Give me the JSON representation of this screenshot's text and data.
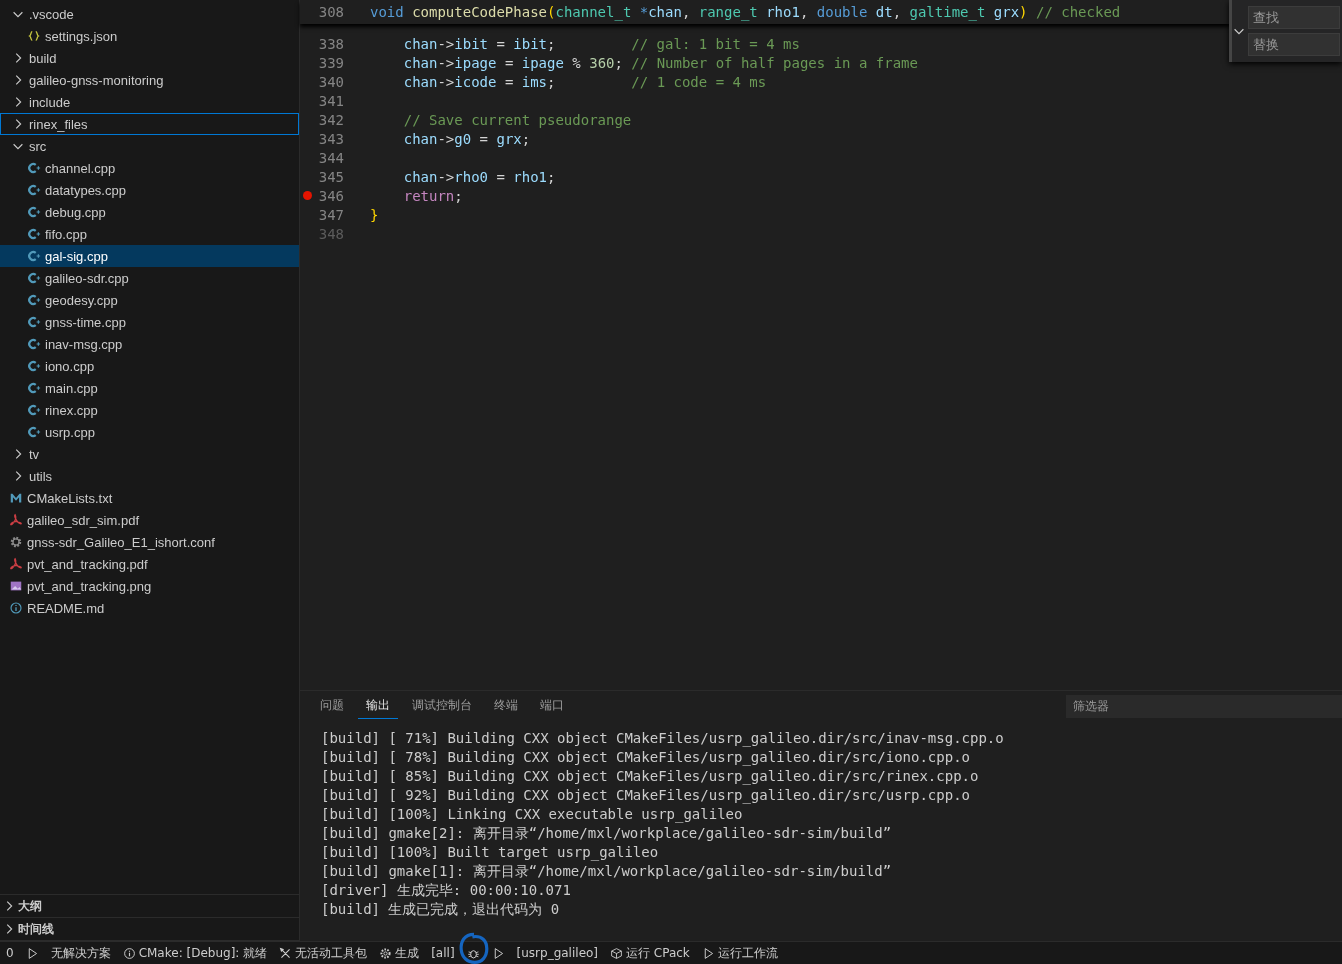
{
  "explorer": {
    "items": [
      {
        "kind": "folder",
        "label": ".vscode",
        "expanded": true,
        "selected": false,
        "focused": false,
        "children": [
          {
            "kind": "json",
            "label": "settings.json",
            "selected": false,
            "focused": false
          }
        ]
      },
      {
        "kind": "folder",
        "label": "build",
        "expanded": false,
        "selected": false,
        "focused": false
      },
      {
        "kind": "folder",
        "label": "galileo-gnss-monitoring",
        "expanded": false,
        "selected": false,
        "focused": false
      },
      {
        "kind": "folder",
        "label": "include",
        "expanded": false,
        "selected": false,
        "focused": false
      },
      {
        "kind": "folder",
        "label": "rinex_files",
        "expanded": false,
        "selected": false,
        "focused": true
      },
      {
        "kind": "folder",
        "label": "src",
        "expanded": true,
        "selected": false,
        "focused": false,
        "children": [
          {
            "kind": "cpp",
            "label": "channel.cpp",
            "selected": false,
            "focused": false
          },
          {
            "kind": "cpp",
            "label": "datatypes.cpp",
            "selected": false,
            "focused": false
          },
          {
            "kind": "cpp",
            "label": "debug.cpp",
            "selected": false,
            "focused": false
          },
          {
            "kind": "cpp",
            "label": "fifo.cpp",
            "selected": false,
            "focused": false
          },
          {
            "kind": "cpp",
            "label": "gal-sig.cpp",
            "selected": true,
            "focused": false
          },
          {
            "kind": "cpp",
            "label": "galileo-sdr.cpp",
            "selected": false,
            "focused": false
          },
          {
            "kind": "cpp",
            "label": "geodesy.cpp",
            "selected": false,
            "focused": false
          },
          {
            "kind": "cpp",
            "label": "gnss-time.cpp",
            "selected": false,
            "focused": false
          },
          {
            "kind": "cpp",
            "label": "inav-msg.cpp",
            "selected": false,
            "focused": false
          },
          {
            "kind": "cpp",
            "label": "iono.cpp",
            "selected": false,
            "focused": false
          },
          {
            "kind": "cpp",
            "label": "main.cpp",
            "selected": false,
            "focused": false
          },
          {
            "kind": "cpp",
            "label": "rinex.cpp",
            "selected": false,
            "focused": false
          },
          {
            "kind": "cpp",
            "label": "usrp.cpp",
            "selected": false,
            "focused": false
          }
        ]
      },
      {
        "kind": "folder",
        "label": "tv",
        "expanded": false,
        "selected": false,
        "focused": false
      },
      {
        "kind": "folder",
        "label": "utils",
        "expanded": false,
        "selected": false,
        "focused": false
      },
      {
        "kind": "cmake",
        "label": "CMakeLists.txt",
        "selected": false,
        "focused": false
      },
      {
        "kind": "pdf",
        "label": "galileo_sdr_sim.pdf",
        "selected": false,
        "focused": false
      },
      {
        "kind": "conf",
        "label": "gnss-sdr_Galileo_E1_ishort.conf",
        "selected": false,
        "focused": false
      },
      {
        "kind": "pdf",
        "label": "pvt_and_tracking.pdf",
        "selected": false,
        "focused": false
      },
      {
        "kind": "image",
        "label": "pvt_and_tracking.png",
        "selected": false,
        "focused": false
      },
      {
        "kind": "info",
        "label": "README.md",
        "selected": false,
        "focused": false
      }
    ]
  },
  "sidebar_sections": [
    {
      "label": "大纲",
      "expanded": false
    },
    {
      "label": "时间线",
      "expanded": false
    }
  ],
  "editor": {
    "sticky_line": {
      "number": "308",
      "tokens": [
        {
          "kind": "kw",
          "text": "void "
        },
        {
          "kind": "fn",
          "text": "computeCodePhase"
        },
        {
          "kind": "paren",
          "text": "("
        },
        {
          "kind": "type",
          "text": "channel_t"
        },
        {
          "kind": "kw",
          "text": " *"
        },
        {
          "kind": "var",
          "text": "chan"
        },
        {
          "kind": "op",
          "text": ", "
        },
        {
          "kind": "type",
          "text": "range_t"
        },
        {
          "kind": "var",
          "text": " rho1"
        },
        {
          "kind": "op",
          "text": ", "
        },
        {
          "kind": "kw",
          "text": "double"
        },
        {
          "kind": "var",
          "text": " dt"
        },
        {
          "kind": "op",
          "text": ", "
        },
        {
          "kind": "type",
          "text": "galtime_t"
        },
        {
          "kind": "var",
          "text": " grx"
        },
        {
          "kind": "paren",
          "text": ")"
        },
        {
          "kind": "cm",
          "text": " // checked"
        }
      ]
    },
    "lines": [
      {
        "number": "338",
        "breakpoint": false,
        "dim": false,
        "tokens": [
          {
            "kind": "var",
            "text": "    chan"
          },
          {
            "kind": "op",
            "text": "->"
          },
          {
            "kind": "var",
            "text": "ibit"
          },
          {
            "kind": "op",
            "text": " = "
          },
          {
            "kind": "var",
            "text": "ibit"
          },
          {
            "kind": "op",
            "text": ";         "
          },
          {
            "kind": "cm",
            "text": "// gal: 1 bit = 4 ms"
          }
        ]
      },
      {
        "number": "339",
        "breakpoint": false,
        "dim": false,
        "tokens": [
          {
            "kind": "var",
            "text": "    chan"
          },
          {
            "kind": "op",
            "text": "->"
          },
          {
            "kind": "var",
            "text": "ipage"
          },
          {
            "kind": "op",
            "text": " = "
          },
          {
            "kind": "var",
            "text": "ipage"
          },
          {
            "kind": "op",
            "text": " % "
          },
          {
            "kind": "num",
            "text": "360"
          },
          {
            "kind": "op",
            "text": "; "
          },
          {
            "kind": "cm",
            "text": "// Number of half pages in a frame"
          }
        ]
      },
      {
        "number": "340",
        "breakpoint": false,
        "dim": false,
        "tokens": [
          {
            "kind": "var",
            "text": "    chan"
          },
          {
            "kind": "op",
            "text": "->"
          },
          {
            "kind": "var",
            "text": "icode"
          },
          {
            "kind": "op",
            "text": " = "
          },
          {
            "kind": "var",
            "text": "ims"
          },
          {
            "kind": "op",
            "text": ";         "
          },
          {
            "kind": "cm",
            "text": "// 1 code = 4 ms"
          }
        ]
      },
      {
        "number": "341",
        "breakpoint": false,
        "dim": false
      },
      {
        "number": "342",
        "breakpoint": false,
        "dim": false,
        "tokens": [
          {
            "kind": "cm",
            "text": "    // Save current pseudorange"
          }
        ]
      },
      {
        "number": "343",
        "breakpoint": false,
        "dim": false,
        "tokens": [
          {
            "kind": "var",
            "text": "    chan"
          },
          {
            "kind": "op",
            "text": "->"
          },
          {
            "kind": "var",
            "text": "g0"
          },
          {
            "kind": "op",
            "text": " = "
          },
          {
            "kind": "var",
            "text": "grx"
          },
          {
            "kind": "op",
            "text": ";"
          }
        ]
      },
      {
        "number": "344",
        "breakpoint": false,
        "dim": false
      },
      {
        "number": "345",
        "breakpoint": false,
        "dim": false,
        "tokens": [
          {
            "kind": "var",
            "text": "    chan"
          },
          {
            "kind": "op",
            "text": "->"
          },
          {
            "kind": "var",
            "text": "rho0"
          },
          {
            "kind": "op",
            "text": " = "
          },
          {
            "kind": "var",
            "text": "rho1"
          },
          {
            "kind": "op",
            "text": ";"
          }
        ]
      },
      {
        "number": "346",
        "breakpoint": true,
        "dim": false,
        "tokens": [
          {
            "kind": "ctrl",
            "text": "    return"
          },
          {
            "kind": "op",
            "text": ";"
          }
        ]
      },
      {
        "number": "347",
        "breakpoint": false,
        "dim": false,
        "tokens": [
          {
            "kind": "paren",
            "text": "}"
          }
        ]
      },
      {
        "number": "348",
        "breakpoint": false,
        "dim": true
      }
    ]
  },
  "find_widget": {
    "find": {
      "placeholder": "查找"
    },
    "replace": {
      "placeholder": "替换"
    }
  },
  "panel": {
    "tabs": [
      {
        "label": "问题",
        "selected": false
      },
      {
        "label": "输出",
        "selected": true
      },
      {
        "label": "调试控制台",
        "selected": false
      },
      {
        "label": "终端",
        "selected": false
      },
      {
        "label": "端口",
        "selected": false
      }
    ],
    "filter": {
      "placeholder": "筛选器"
    },
    "output": [
      "[build] [ 71%] Building CXX object CMakeFiles/usrp_galileo.dir/src/inav-msg.cpp.o",
      "[build] [ 78%] Building CXX object CMakeFiles/usrp_galileo.dir/src/iono.cpp.o",
      "[build] [ 85%] Building CXX object CMakeFiles/usrp_galileo.dir/src/rinex.cpp.o",
      "[build] [ 92%] Building CXX object CMakeFiles/usrp_galileo.dir/src/usrp.cpp.o",
      "[build] [100%] Linking CXX executable usrp_galileo",
      "[build] gmake[2]: 离开目录“/home/mxl/workplace/galileo-sdr-sim/build”",
      "[build] [100%] Built target usrp_galileo",
      "[build] gmake[1]: 离开目录“/home/mxl/workplace/galileo-sdr-sim/build”",
      "[driver] 生成完毕: 00:00:10.071",
      "[build] 生成已完成，退出代码为 0"
    ]
  },
  "status_bar": [
    {
      "kind": "text",
      "label": "0",
      "circled": false
    },
    {
      "kind": "run-config",
      "circled": false
    },
    {
      "kind": "text",
      "label": "无解决方案",
      "circled": false
    },
    {
      "kind": "info",
      "label": "CMake: [Debug]: 就绪",
      "circled": false
    },
    {
      "kind": "tools",
      "label": "无活动工具包",
      "circled": false
    },
    {
      "kind": "gear",
      "label": "生成",
      "circled": false
    },
    {
      "kind": "text",
      "label": "[all]",
      "circled": false
    },
    {
      "kind": "bug",
      "circled": true
    },
    {
      "kind": "play",
      "circled": false
    },
    {
      "kind": "text",
      "label": "[usrp_galileo]",
      "circled": false
    },
    {
      "kind": "box",
      "label": "运行 CPack",
      "circled": false
    },
    {
      "kind": "play",
      "label": "运行工作流",
      "circled": false
    }
  ]
}
